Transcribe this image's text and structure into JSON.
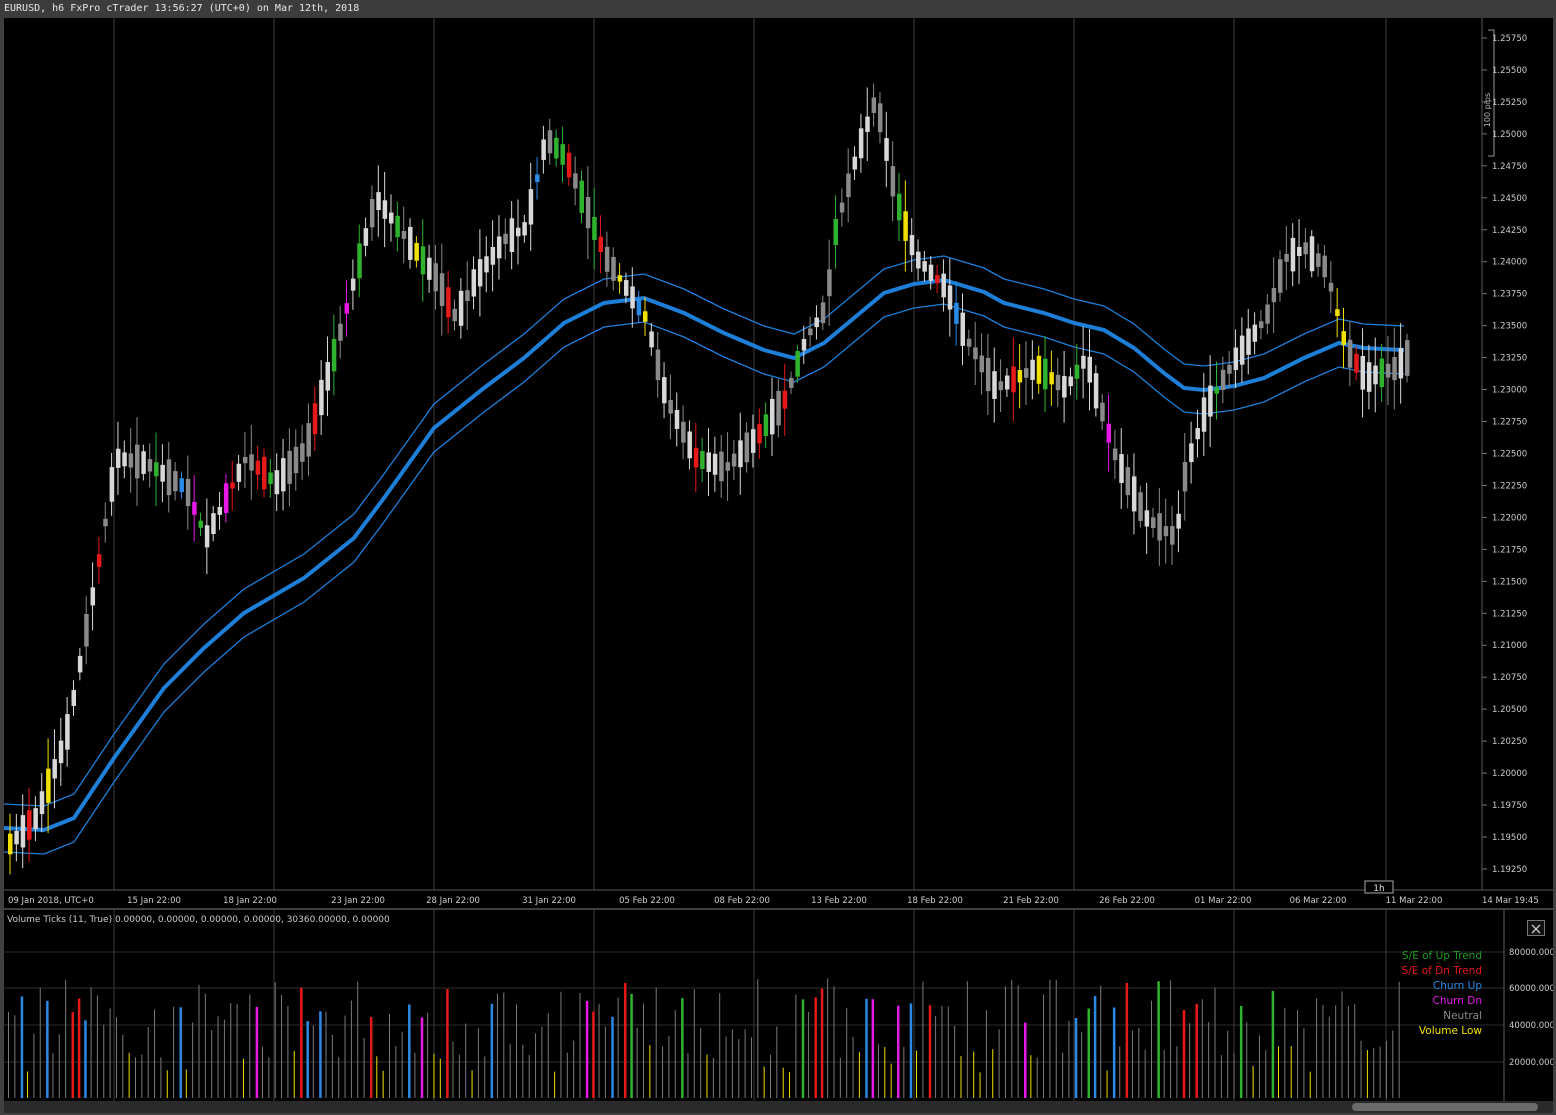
{
  "window": {
    "title": "EURUSD, h6 FxPro cTrader 13:56:27 (UTC+0) on Mar 12th, 2018"
  },
  "main_chart": {
    "price_labels": [
      "1.25750",
      "1.25500",
      "1.25250",
      "1.25000",
      "1.24750",
      "1.24500",
      "1.24250",
      "1.24000",
      "1.23750",
      "1.23500",
      "1.23250",
      "1.23000",
      "1.22750",
      "1.22500",
      "1.22250",
      "1.22000",
      "1.21750",
      "1.21500",
      "1.21250",
      "1.21000",
      "1.20750",
      "1.20500",
      "1.20250",
      "1.20000",
      "1.19750",
      "1.19500",
      "1.19250"
    ],
    "time_labels": [
      "09 Jan 2018, UTC+0",
      "15 Jan 22:00",
      "18 Jan 22:00",
      "23 Jan 22:00",
      "28 Jan 22:00",
      "31 Jan 22:00",
      "05 Feb 22:00",
      "08 Feb 22:00",
      "13 Feb 22:00",
      "18 Feb 22:00",
      "21 Feb 22:00",
      "26 Feb 22:00",
      "01 Mar 22:00",
      "06 Mar 22:00",
      "11 Mar 22:00",
      "14 Mar 19:45"
    ],
    "pips_label": "100 pips",
    "timeframe_badge": "1h",
    "colors": {
      "band": "#1e7fd8",
      "up": "#2fb32f",
      "down": "#e61919",
      "churn_up": "#2a8ae6",
      "churn_dn": "#e619e6",
      "neutral_up": "#d8d8d8",
      "neutral_dn": "#8a8a8a",
      "low": "#f0e000"
    }
  },
  "volume_panel": {
    "header": "Volume Ticks (11, True) 0.00000, 0.00000, 0.00000, 0.00000, 30360.00000, 0.00000",
    "scale_labels": [
      "80000.000",
      "60000.000",
      "40000.000",
      "20000.000"
    ],
    "legend": [
      {
        "label": "S/E of Up Trend",
        "color": "#1f9a1f"
      },
      {
        "label": "S/E of Dn Trend",
        "color": "#e61919"
      },
      {
        "label": "Churn Up",
        "color": "#2a8ae6"
      },
      {
        "label": "Churn Dn",
        "color": "#e619e6"
      },
      {
        "label": "Neutral",
        "color": "#8a8a8a"
      },
      {
        "label": "Volume Low",
        "color": "#f0e000"
      }
    ]
  }
}
